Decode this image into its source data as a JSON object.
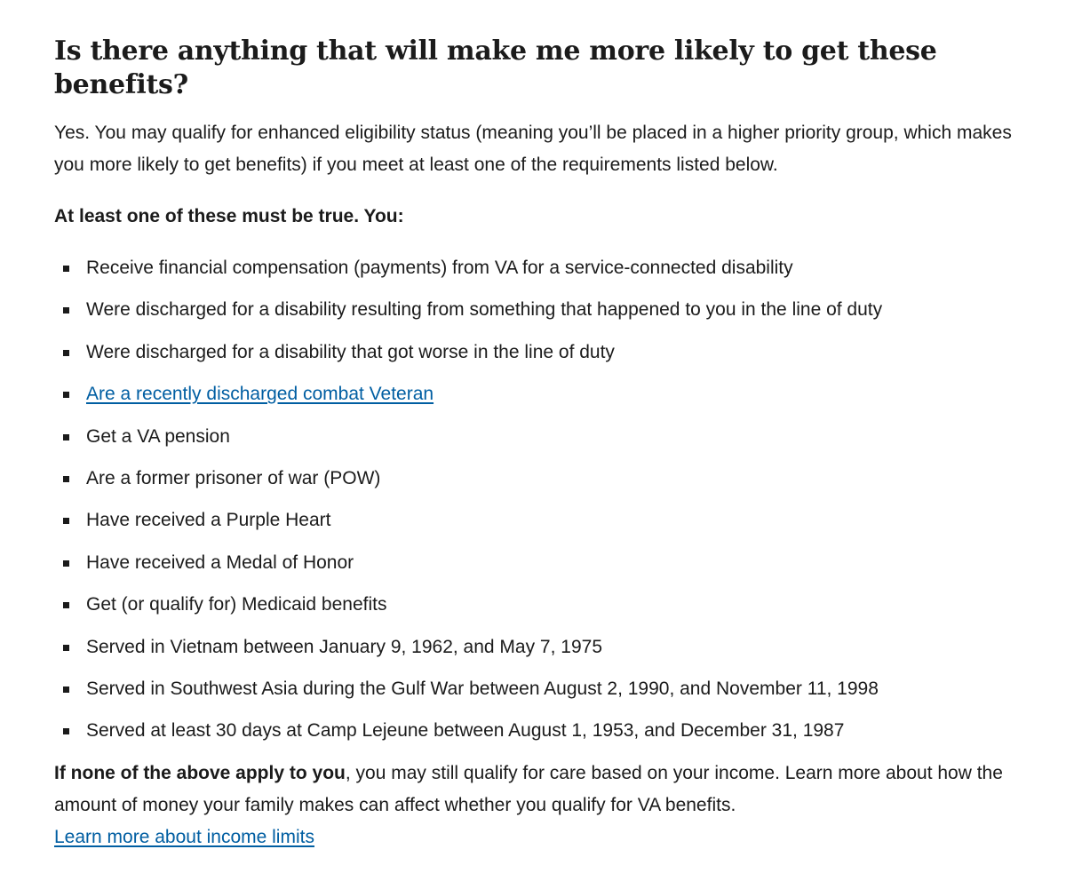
{
  "section": {
    "heading": "Is there anything that will make me more likely to get these benefits?",
    "intro": "Yes. You may qualify for enhanced eligibility status (meaning you’ll be placed in a higher priority group, which makes you more likely to get benefits) if you meet at least one of the requirements listed below.",
    "lead": "At least one of these must be true. You:",
    "requirements": [
      {
        "text": "Receive financial compensation (payments) from VA for a service-connected disability",
        "is_link": false
      },
      {
        "text": "Were discharged for a disability resulting from something that happened to you in the line of duty",
        "is_link": false
      },
      {
        "text": "Were discharged for a disability that got worse in the line of duty",
        "is_link": false
      },
      {
        "text": "Are a recently discharged combat Veteran",
        "is_link": true
      },
      {
        "text": "Get a VA pension",
        "is_link": false
      },
      {
        "text": "Are a former prisoner of war (POW)",
        "is_link": false
      },
      {
        "text": "Have received a Purple Heart",
        "is_link": false
      },
      {
        "text": "Have received a Medal of Honor",
        "is_link": false
      },
      {
        "text": "Get (or qualify for) Medicaid benefits",
        "is_link": false
      },
      {
        "text": "Served in Vietnam between January 9, 1962, and May 7, 1975",
        "is_link": false
      },
      {
        "text": "Served in Southwest Asia during the Gulf War between August 2, 1990, and November 11, 1998",
        "is_link": false
      },
      {
        "text": "Served at least 30 days at Camp Lejeune between August 1, 1953, and December 31, 1987",
        "is_link": false
      }
    ],
    "outro_bold": "If none of the above apply to you",
    "outro_text": ", you may still qualify for care based on your income. Learn more about how the amount of money your family makes can affect whether you qualify for VA benefits.",
    "income_link": "Learn more about income limits"
  },
  "colors": {
    "text": "#1b1b1b",
    "link": "#005ea2"
  }
}
